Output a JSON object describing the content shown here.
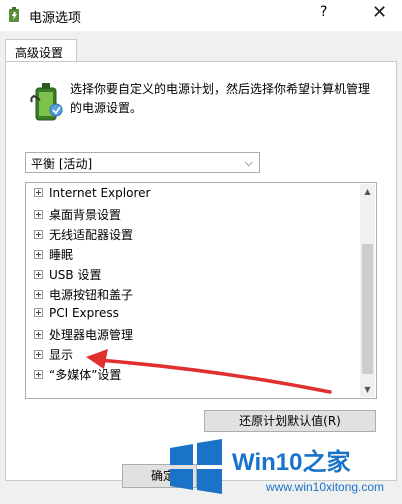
{
  "window": {
    "title": "电源选项",
    "help_glyph": "?",
    "close_glyph": "✕"
  },
  "tab": {
    "label": "高级设置"
  },
  "description": "选择你要自定义的电源计划，然后选择你希望计算机管理的电源设置。",
  "plan_select": {
    "value": "平衡 [活动]"
  },
  "settings_tree": {
    "items": [
      "Internet Explorer",
      "桌面背景设置",
      "无线适配器设置",
      "睡眠",
      "USB 设置",
      "电源按钮和盖子",
      "PCI Express",
      "处理器电源管理",
      "显示",
      "“多媒体”设置"
    ]
  },
  "buttons": {
    "restore": "还原计划默认值(R)",
    "ok": "确定"
  },
  "watermark": {
    "name": "Win10之家",
    "url": "www.win10xitong.com"
  },
  "colors": {
    "arrow": "#e03030",
    "watermark": "#1a73c9"
  }
}
